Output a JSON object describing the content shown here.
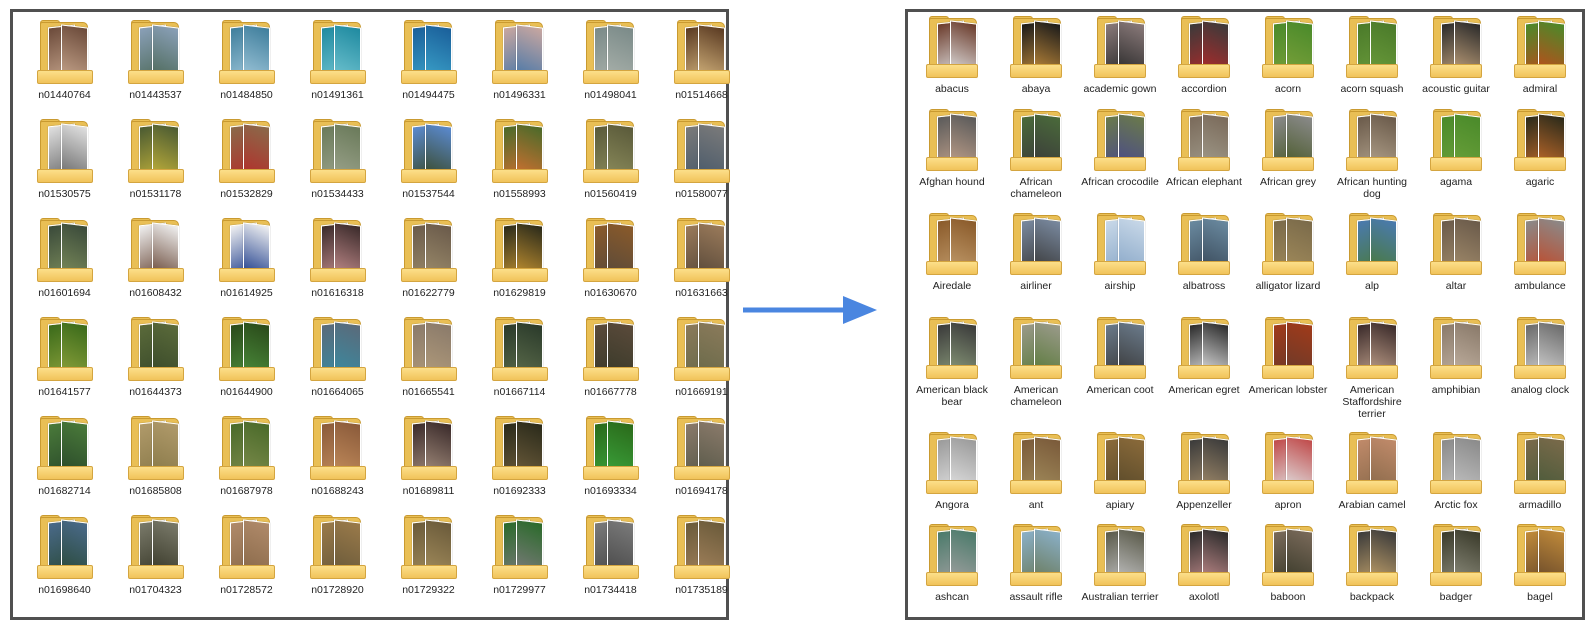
{
  "left_panel": {
    "folders": [
      {
        "label": "n01440764",
        "colors": [
          "#6b4a3a",
          "#c4a38a"
        ]
      },
      {
        "label": "n01443537",
        "colors": [
          "#8aa0b8",
          "#4e6a5a"
        ]
      },
      {
        "label": "n01484850",
        "colors": [
          "#3f7e9c",
          "#9cc4d8"
        ]
      },
      {
        "label": "n01491361",
        "colors": [
          "#1f8aa0",
          "#6ec2cf"
        ]
      },
      {
        "label": "n01494475",
        "colors": [
          "#1a5f9a",
          "#3aa0c8"
        ]
      },
      {
        "label": "n01496331",
        "colors": [
          "#c9a7a0",
          "#4877a8"
        ]
      },
      {
        "label": "n01498041",
        "colors": [
          "#7a8a88",
          "#a8b0aa"
        ]
      },
      {
        "label": "n01514668",
        "colors": [
          "#5a3a22",
          "#d0b07a"
        ]
      },
      {
        "label": "n01530575",
        "colors": [
          "#e0e0e0",
          "#6a6a6a"
        ]
      },
      {
        "label": "n01531178",
        "colors": [
          "#4a5a32",
          "#c0b03a"
        ]
      },
      {
        "label": "n01532829",
        "colors": [
          "#8a6a4a",
          "#b42e2a"
        ]
      },
      {
        "label": "n01534433",
        "colors": [
          "#6a7a5a",
          "#9aa28a"
        ]
      },
      {
        "label": "n01537544",
        "colors": [
          "#5a8ad0",
          "#3a4a2a"
        ]
      },
      {
        "label": "n01558993",
        "colors": [
          "#4a6a2a",
          "#d07030"
        ]
      },
      {
        "label": "n01560419",
        "colors": [
          "#5a5a3a",
          "#8a8a5a"
        ]
      },
      {
        "label": "n01580077",
        "colors": [
          "#7a7a7a",
          "#4a5a6a"
        ]
      },
      {
        "label": "n01601694",
        "colors": [
          "#3a4a3a",
          "#7a8a5a"
        ]
      },
      {
        "label": "n01608432",
        "colors": [
          "#f0f0f0",
          "#6a4a3a"
        ]
      },
      {
        "label": "n01614925",
        "colors": [
          "#f2f2f2",
          "#1a3a8a"
        ]
      },
      {
        "label": "n01616318",
        "colors": [
          "#3a2a2a",
          "#c08a8a"
        ]
      },
      {
        "label": "n01622779",
        "colors": [
          "#6a5a4a",
          "#9a8a6a"
        ]
      },
      {
        "label": "n01629819",
        "colors": [
          "#2a2a1a",
          "#c09030"
        ]
      },
      {
        "label": "n01630670",
        "colors": [
          "#8a5a2a",
          "#5a4a3a"
        ]
      },
      {
        "label": "n01631663",
        "colors": [
          "#9a7a5a",
          "#5a4a3a"
        ]
      },
      {
        "label": "n01641577",
        "colors": [
          "#3a6a1a",
          "#8aa03a"
        ]
      },
      {
        "label": "n01644373",
        "colors": [
          "#5a6a3a",
          "#3a4a2a"
        ]
      },
      {
        "label": "n01644900",
        "colors": [
          "#2a4a1a",
          "#4a8a3a"
        ]
      },
      {
        "label": "n01664065",
        "colors": [
          "#5a6a7a",
          "#3a8aa0"
        ]
      },
      {
        "label": "n01665541",
        "colors": [
          "#8a7a6a",
          "#b09a7a"
        ]
      },
      {
        "label": "n01667114",
        "colors": [
          "#2a3a2a",
          "#5a6a4a"
        ]
      },
      {
        "label": "n01667778",
        "colors": [
          "#5a4a3a",
          "#3a3a2a"
        ]
      },
      {
        "label": "n01669191",
        "colors": [
          "#8a7a5a",
          "#6a6a4a"
        ]
      },
      {
        "label": "n01682714",
        "colors": [
          "#4a7a3a",
          "#2a4a2a"
        ]
      },
      {
        "label": "n01685808",
        "colors": [
          "#b09a6a",
          "#8a7a4a"
        ]
      },
      {
        "label": "n01687978",
        "colors": [
          "#4a6a2a",
          "#7a8a4a"
        ]
      },
      {
        "label": "n01688243",
        "colors": [
          "#8a5a3a",
          "#c08a5a"
        ]
      },
      {
        "label": "n01689811",
        "colors": [
          "#3a2a2a",
          "#a08a7a"
        ]
      },
      {
        "label": "n01692333",
        "colors": [
          "#2a2a1a",
          "#6a5a3a"
        ]
      },
      {
        "label": "n01693334",
        "colors": [
          "#2a6a1a",
          "#3aa03a"
        ]
      },
      {
        "label": "n01694178",
        "colors": [
          "#8a7a6a",
          "#5a5a4a"
        ]
      },
      {
        "label": "n01698640",
        "colors": [
          "#4a6a8a",
          "#2a4a3a"
        ]
      },
      {
        "label": "n01704323",
        "colors": [
          "#7a7a6a",
          "#3a3a2a"
        ]
      },
      {
        "label": "n01728572",
        "colors": [
          "#b08a6a",
          "#8a6a4a"
        ]
      },
      {
        "label": "n01728920",
        "colors": [
          "#9a7a4a",
          "#6a5a3a"
        ]
      },
      {
        "label": "n01729322",
        "colors": [
          "#6a5a3a",
          "#a08a5a"
        ]
      },
      {
        "label": "n01729977",
        "colors": [
          "#2a6a2a",
          "#7a7a7a"
        ]
      },
      {
        "label": "n01734418",
        "colors": [
          "#7a7a7a",
          "#4a4a4a"
        ]
      },
      {
        "label": "n01735189",
        "colors": [
          "#6a5a3a",
          "#a0805a"
        ]
      }
    ]
  },
  "right_panel": {
    "folders": [
      {
        "label": "abacus",
        "colors": [
          "#6a3a2a",
          "#e0e0e0"
        ]
      },
      {
        "label": "abaya",
        "colors": [
          "#1a1a1a",
          "#c08a3a"
        ]
      },
      {
        "label": "academic gown",
        "colors": [
          "#8a7a7a",
          "#2a2a2a"
        ]
      },
      {
        "label": "accordion",
        "colors": [
          "#3a3a3a",
          "#b02a2a"
        ]
      },
      {
        "label": "acorn",
        "colors": [
          "#4a8a2a",
          "#7aa03a"
        ]
      },
      {
        "label": "acorn squash",
        "colors": [
          "#4a7a2a",
          "#6a9a3a"
        ]
      },
      {
        "label": "acoustic guitar",
        "colors": [
          "#2a2a2a",
          "#c0a07a"
        ]
      },
      {
        "label": "admiral",
        "colors": [
          "#4a8a2a",
          "#c04a1a"
        ]
      },
      {
        "label": "Afghan hound",
        "colors": [
          "#5a5a5a",
          "#c0a08a"
        ]
      },
      {
        "label": "African chameleon",
        "colors": [
          "#4a6a3a",
          "#3a3a3a"
        ]
      },
      {
        "label": "African crocodile",
        "colors": [
          "#6a7a4a",
          "#4a4a8a"
        ]
      },
      {
        "label": "African elephant",
        "colors": [
          "#7a6a5a",
          "#a09a8a"
        ]
      },
      {
        "label": "African grey",
        "colors": [
          "#8a8a8a",
          "#4a5a2a"
        ]
      },
      {
        "label": "African hunting dog",
        "colors": [
          "#6a5a4a",
          "#b0a08a"
        ]
      },
      {
        "label": "agama",
        "colors": [
          "#4a8a2a",
          "#6aa03a"
        ]
      },
      {
        "label": "agaric",
        "colors": [
          "#2a2a1a",
          "#c06a2a"
        ]
      },
      {
        "label": "Airedale",
        "colors": [
          "#8a5a2a",
          "#c09a6a"
        ]
      },
      {
        "label": "airliner",
        "colors": [
          "#7a8aa0",
          "#3a3a3a"
        ]
      },
      {
        "label": "airship",
        "colors": [
          "#c8d8e8",
          "#8aa8c8"
        ]
      },
      {
        "label": "albatross",
        "colors": [
          "#6a8aa0",
          "#3a4a5a"
        ]
      },
      {
        "label": "alligator lizard",
        "colors": [
          "#7a6a4a",
          "#a08a5a"
        ]
      },
      {
        "label": "alp",
        "colors": [
          "#4a7ab0",
          "#4a7a3a"
        ]
      },
      {
        "label": "altar",
        "colors": [
          "#6a5a4a",
          "#a08a6a"
        ]
      },
      {
        "label": "ambulance",
        "colors": [
          "#8a8a8a",
          "#c04a2a"
        ]
      },
      {
        "label": "American black bear",
        "colors": [
          "#3a3a3a",
          "#8a9a7a"
        ]
      },
      {
        "label": "American chameleon",
        "colors": [
          "#9a9a8a",
          "#5a7a3a"
        ]
      },
      {
        "label": "American coot",
        "colors": [
          "#6a7a8a",
          "#3a3a3a"
        ]
      },
      {
        "label": "American egret",
        "colors": [
          "#2a2a2a",
          "#e0e0e0"
        ]
      },
      {
        "label": "American lobster",
        "colors": [
          "#a03a1a",
          "#6a3a2a"
        ]
      },
      {
        "label": "American Staffordshire terrier",
        "colors": [
          "#3a2a2a",
          "#c0a08a"
        ]
      },
      {
        "label": "amphibian",
        "colors": [
          "#8a7a6a",
          "#c0b0a0"
        ]
      },
      {
        "label": "analog clock",
        "colors": [
          "#6a6a6a",
          "#d0d0d0"
        ]
      },
      {
        "label": "Angora",
        "colors": [
          "#9a9a9a",
          "#e0e0e0"
        ]
      },
      {
        "label": "ant",
        "colors": [
          "#7a5a3a",
          "#a08a5a"
        ]
      },
      {
        "label": "apiary",
        "colors": [
          "#8a6a3a",
          "#5a4a2a"
        ]
      },
      {
        "label": "Appenzeller",
        "colors": [
          "#3a3a3a",
          "#a08a6a"
        ]
      },
      {
        "label": "apron",
        "colors": [
          "#c04a4a",
          "#e0e0e0"
        ]
      },
      {
        "label": "Arabian camel",
        "colors": [
          "#c08a6a",
          "#8a6a4a"
        ]
      },
      {
        "label": "Arctic fox",
        "colors": [
          "#8a8a8a",
          "#c0c0c0"
        ]
      },
      {
        "label": "armadillo",
        "colors": [
          "#7a6a4a",
          "#4a5a3a"
        ]
      },
      {
        "label": "ashcan",
        "colors": [
          "#4a7a6a",
          "#a0a0a0"
        ]
      },
      {
        "label": "assault rifle",
        "colors": [
          "#8ab0c8",
          "#6a7a5a"
        ]
      },
      {
        "label": "Australian terrier",
        "colors": [
          "#5a5a4a",
          "#c0c0c0"
        ]
      },
      {
        "label": "axolotl",
        "colors": [
          "#2a2a2a",
          "#c08a8a"
        ]
      },
      {
        "label": "baboon",
        "colors": [
          "#7a6a5a",
          "#3a3a2a"
        ]
      },
      {
        "label": "backpack",
        "colors": [
          "#3a3a3a",
          "#c0a06a"
        ]
      },
      {
        "label": "badger",
        "colors": [
          "#3a3a2a",
          "#8a8a7a"
        ]
      },
      {
        "label": "bagel",
        "colors": [
          "#c08a3a",
          "#6a4a2a"
        ]
      }
    ]
  },
  "arrow": {
    "color": "#4a86e0"
  }
}
